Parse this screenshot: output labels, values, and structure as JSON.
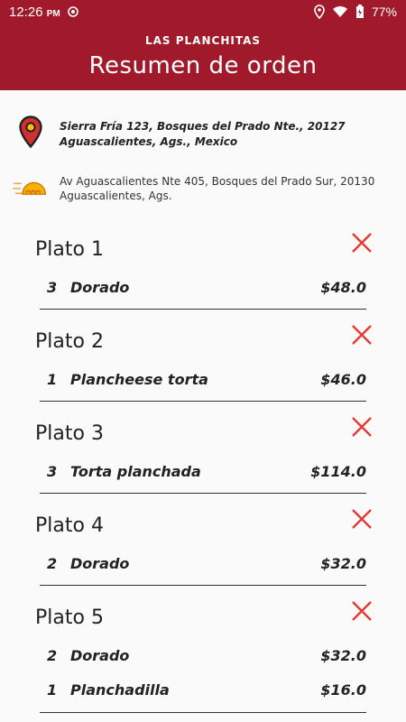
{
  "status_bar": {
    "time": "12:26",
    "ampm": "PM",
    "battery": "77%"
  },
  "header": {
    "brand": "LAS PLANCHITAS",
    "title": "Resumen de orden"
  },
  "addresses": {
    "pickup": "Sierra Fría 123, Bosques del Prado Nte., 20127 Aguascalientes, Ags., Mexico",
    "restaurant": "Av Aguascalientes Nte 405, Bosques del Prado Sur, 20130 Aguascalientes, Ags."
  },
  "plates": [
    {
      "title": "Plato 1",
      "items": [
        {
          "qty": "3",
          "name": "Dorado",
          "price": "$48.0"
        }
      ]
    },
    {
      "title": "Plato 2",
      "items": [
        {
          "qty": "1",
          "name": "Plancheese torta",
          "price": "$46.0"
        }
      ]
    },
    {
      "title": "Plato 3",
      "items": [
        {
          "qty": "3",
          "name": "Torta planchada",
          "price": "$114.0"
        }
      ]
    },
    {
      "title": "Plato 4",
      "items": [
        {
          "qty": "2",
          "name": "Dorado",
          "price": "$32.0"
        }
      ]
    },
    {
      "title": "Plato 5",
      "items": [
        {
          "qty": "2",
          "name": "Dorado",
          "price": "$32.0"
        },
        {
          "qty": "1",
          "name": "Planchadilla",
          "price": "$16.0"
        }
      ]
    }
  ],
  "colors": {
    "header": "#a11a2b",
    "remove": "#e53935",
    "pin": "#c62828"
  },
  "icons": {
    "location": "location-pin-icon",
    "restaurant": "taco-icon",
    "remove": "close-icon"
  }
}
